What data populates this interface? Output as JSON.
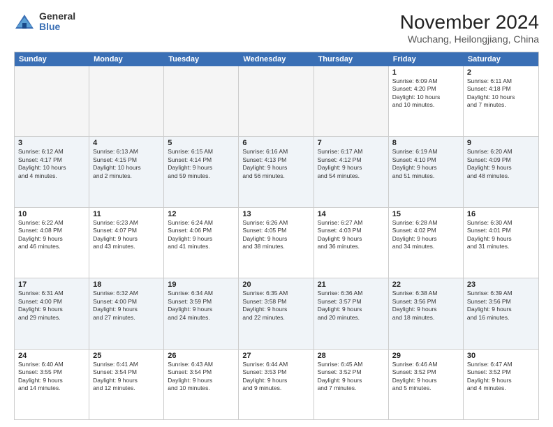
{
  "logo": {
    "general": "General",
    "blue": "Blue"
  },
  "title": "November 2024",
  "location": "Wuchang, Heilongjiang, China",
  "days_of_week": [
    "Sunday",
    "Monday",
    "Tuesday",
    "Wednesday",
    "Thursday",
    "Friday",
    "Saturday"
  ],
  "weeks": [
    [
      {
        "day": "",
        "info": ""
      },
      {
        "day": "",
        "info": ""
      },
      {
        "day": "",
        "info": ""
      },
      {
        "day": "",
        "info": ""
      },
      {
        "day": "",
        "info": ""
      },
      {
        "day": "1",
        "info": "Sunrise: 6:09 AM\nSunset: 4:20 PM\nDaylight: 10 hours\nand 10 minutes."
      },
      {
        "day": "2",
        "info": "Sunrise: 6:11 AM\nSunset: 4:18 PM\nDaylight: 10 hours\nand 7 minutes."
      }
    ],
    [
      {
        "day": "3",
        "info": "Sunrise: 6:12 AM\nSunset: 4:17 PM\nDaylight: 10 hours\nand 4 minutes."
      },
      {
        "day": "4",
        "info": "Sunrise: 6:13 AM\nSunset: 4:15 PM\nDaylight: 10 hours\nand 2 minutes."
      },
      {
        "day": "5",
        "info": "Sunrise: 6:15 AM\nSunset: 4:14 PM\nDaylight: 9 hours\nand 59 minutes."
      },
      {
        "day": "6",
        "info": "Sunrise: 6:16 AM\nSunset: 4:13 PM\nDaylight: 9 hours\nand 56 minutes."
      },
      {
        "day": "7",
        "info": "Sunrise: 6:17 AM\nSunset: 4:12 PM\nDaylight: 9 hours\nand 54 minutes."
      },
      {
        "day": "8",
        "info": "Sunrise: 6:19 AM\nSunset: 4:10 PM\nDaylight: 9 hours\nand 51 minutes."
      },
      {
        "day": "9",
        "info": "Sunrise: 6:20 AM\nSunset: 4:09 PM\nDaylight: 9 hours\nand 48 minutes."
      }
    ],
    [
      {
        "day": "10",
        "info": "Sunrise: 6:22 AM\nSunset: 4:08 PM\nDaylight: 9 hours\nand 46 minutes."
      },
      {
        "day": "11",
        "info": "Sunrise: 6:23 AM\nSunset: 4:07 PM\nDaylight: 9 hours\nand 43 minutes."
      },
      {
        "day": "12",
        "info": "Sunrise: 6:24 AM\nSunset: 4:06 PM\nDaylight: 9 hours\nand 41 minutes."
      },
      {
        "day": "13",
        "info": "Sunrise: 6:26 AM\nSunset: 4:05 PM\nDaylight: 9 hours\nand 38 minutes."
      },
      {
        "day": "14",
        "info": "Sunrise: 6:27 AM\nSunset: 4:03 PM\nDaylight: 9 hours\nand 36 minutes."
      },
      {
        "day": "15",
        "info": "Sunrise: 6:28 AM\nSunset: 4:02 PM\nDaylight: 9 hours\nand 34 minutes."
      },
      {
        "day": "16",
        "info": "Sunrise: 6:30 AM\nSunset: 4:01 PM\nDaylight: 9 hours\nand 31 minutes."
      }
    ],
    [
      {
        "day": "17",
        "info": "Sunrise: 6:31 AM\nSunset: 4:00 PM\nDaylight: 9 hours\nand 29 minutes."
      },
      {
        "day": "18",
        "info": "Sunrise: 6:32 AM\nSunset: 4:00 PM\nDaylight: 9 hours\nand 27 minutes."
      },
      {
        "day": "19",
        "info": "Sunrise: 6:34 AM\nSunset: 3:59 PM\nDaylight: 9 hours\nand 24 minutes."
      },
      {
        "day": "20",
        "info": "Sunrise: 6:35 AM\nSunset: 3:58 PM\nDaylight: 9 hours\nand 22 minutes."
      },
      {
        "day": "21",
        "info": "Sunrise: 6:36 AM\nSunset: 3:57 PM\nDaylight: 9 hours\nand 20 minutes."
      },
      {
        "day": "22",
        "info": "Sunrise: 6:38 AM\nSunset: 3:56 PM\nDaylight: 9 hours\nand 18 minutes."
      },
      {
        "day": "23",
        "info": "Sunrise: 6:39 AM\nSunset: 3:56 PM\nDaylight: 9 hours\nand 16 minutes."
      }
    ],
    [
      {
        "day": "24",
        "info": "Sunrise: 6:40 AM\nSunset: 3:55 PM\nDaylight: 9 hours\nand 14 minutes."
      },
      {
        "day": "25",
        "info": "Sunrise: 6:41 AM\nSunset: 3:54 PM\nDaylight: 9 hours\nand 12 minutes."
      },
      {
        "day": "26",
        "info": "Sunrise: 6:43 AM\nSunset: 3:54 PM\nDaylight: 9 hours\nand 10 minutes."
      },
      {
        "day": "27",
        "info": "Sunrise: 6:44 AM\nSunset: 3:53 PM\nDaylight: 9 hours\nand 9 minutes."
      },
      {
        "day": "28",
        "info": "Sunrise: 6:45 AM\nSunset: 3:52 PM\nDaylight: 9 hours\nand 7 minutes."
      },
      {
        "day": "29",
        "info": "Sunrise: 6:46 AM\nSunset: 3:52 PM\nDaylight: 9 hours\nand 5 minutes."
      },
      {
        "day": "30",
        "info": "Sunrise: 6:47 AM\nSunset: 3:52 PM\nDaylight: 9 hours\nand 4 minutes."
      }
    ]
  ]
}
